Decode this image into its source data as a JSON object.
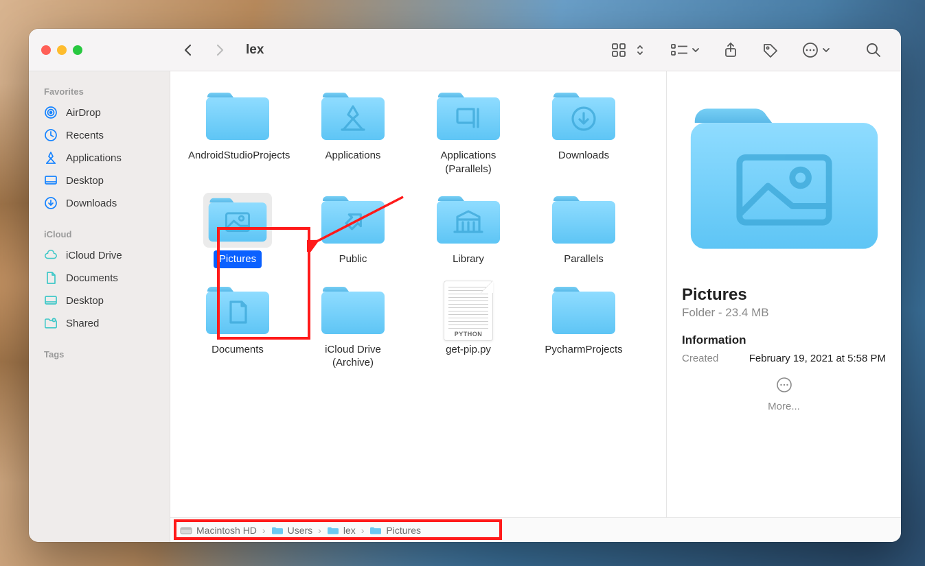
{
  "window": {
    "title": "lex"
  },
  "sidebar": {
    "sections": [
      {
        "label": "Favorites",
        "items": [
          {
            "icon": "airdrop",
            "label": "AirDrop"
          },
          {
            "icon": "recents",
            "label": "Recents"
          },
          {
            "icon": "applications",
            "label": "Applications"
          },
          {
            "icon": "desktop",
            "label": "Desktop"
          },
          {
            "icon": "downloads",
            "label": "Downloads"
          }
        ]
      },
      {
        "label": "iCloud",
        "items": [
          {
            "icon": "icloud",
            "label": "iCloud Drive"
          },
          {
            "icon": "documents",
            "label": "Documents"
          },
          {
            "icon": "desktop-cloud",
            "label": "Desktop"
          },
          {
            "icon": "shared",
            "label": "Shared"
          }
        ]
      },
      {
        "label": "Tags",
        "items": []
      }
    ]
  },
  "files": [
    {
      "name": "AndroidStudioProjects",
      "type": "folder",
      "glyph": "generic"
    },
    {
      "name": "Applications",
      "type": "folder",
      "glyph": "applications"
    },
    {
      "name": "Applications (Parallels)",
      "type": "folder",
      "glyph": "parallels"
    },
    {
      "name": "Downloads",
      "type": "folder",
      "glyph": "downloads"
    },
    {
      "name": "Pictures",
      "type": "folder",
      "glyph": "pictures",
      "selected": true
    },
    {
      "name": "Public",
      "type": "folder",
      "glyph": "public"
    },
    {
      "name": "Library",
      "type": "folder",
      "glyph": "library"
    },
    {
      "name": "Parallels",
      "type": "folder",
      "glyph": "generic"
    },
    {
      "name": "Documents",
      "type": "folder",
      "glyph": "documents"
    },
    {
      "name": "iCloud Drive (Archive)",
      "type": "folder",
      "glyph": "generic"
    },
    {
      "name": "get-pip.py",
      "type": "file",
      "badge": "PYTHON"
    },
    {
      "name": "PycharmProjects",
      "type": "folder",
      "glyph": "generic"
    }
  ],
  "preview": {
    "name": "Pictures",
    "kind_size": "Folder - 23.4 MB",
    "info_heading": "Information",
    "created_label": "Created",
    "created_value": "February 19, 2021 at 5:58 PM",
    "more_label": "More..."
  },
  "pathbar": [
    {
      "icon": "disk",
      "label": "Macintosh HD"
    },
    {
      "icon": "folder",
      "label": "Users"
    },
    {
      "icon": "folder",
      "label": "lex"
    },
    {
      "icon": "folder",
      "label": "Pictures"
    }
  ]
}
